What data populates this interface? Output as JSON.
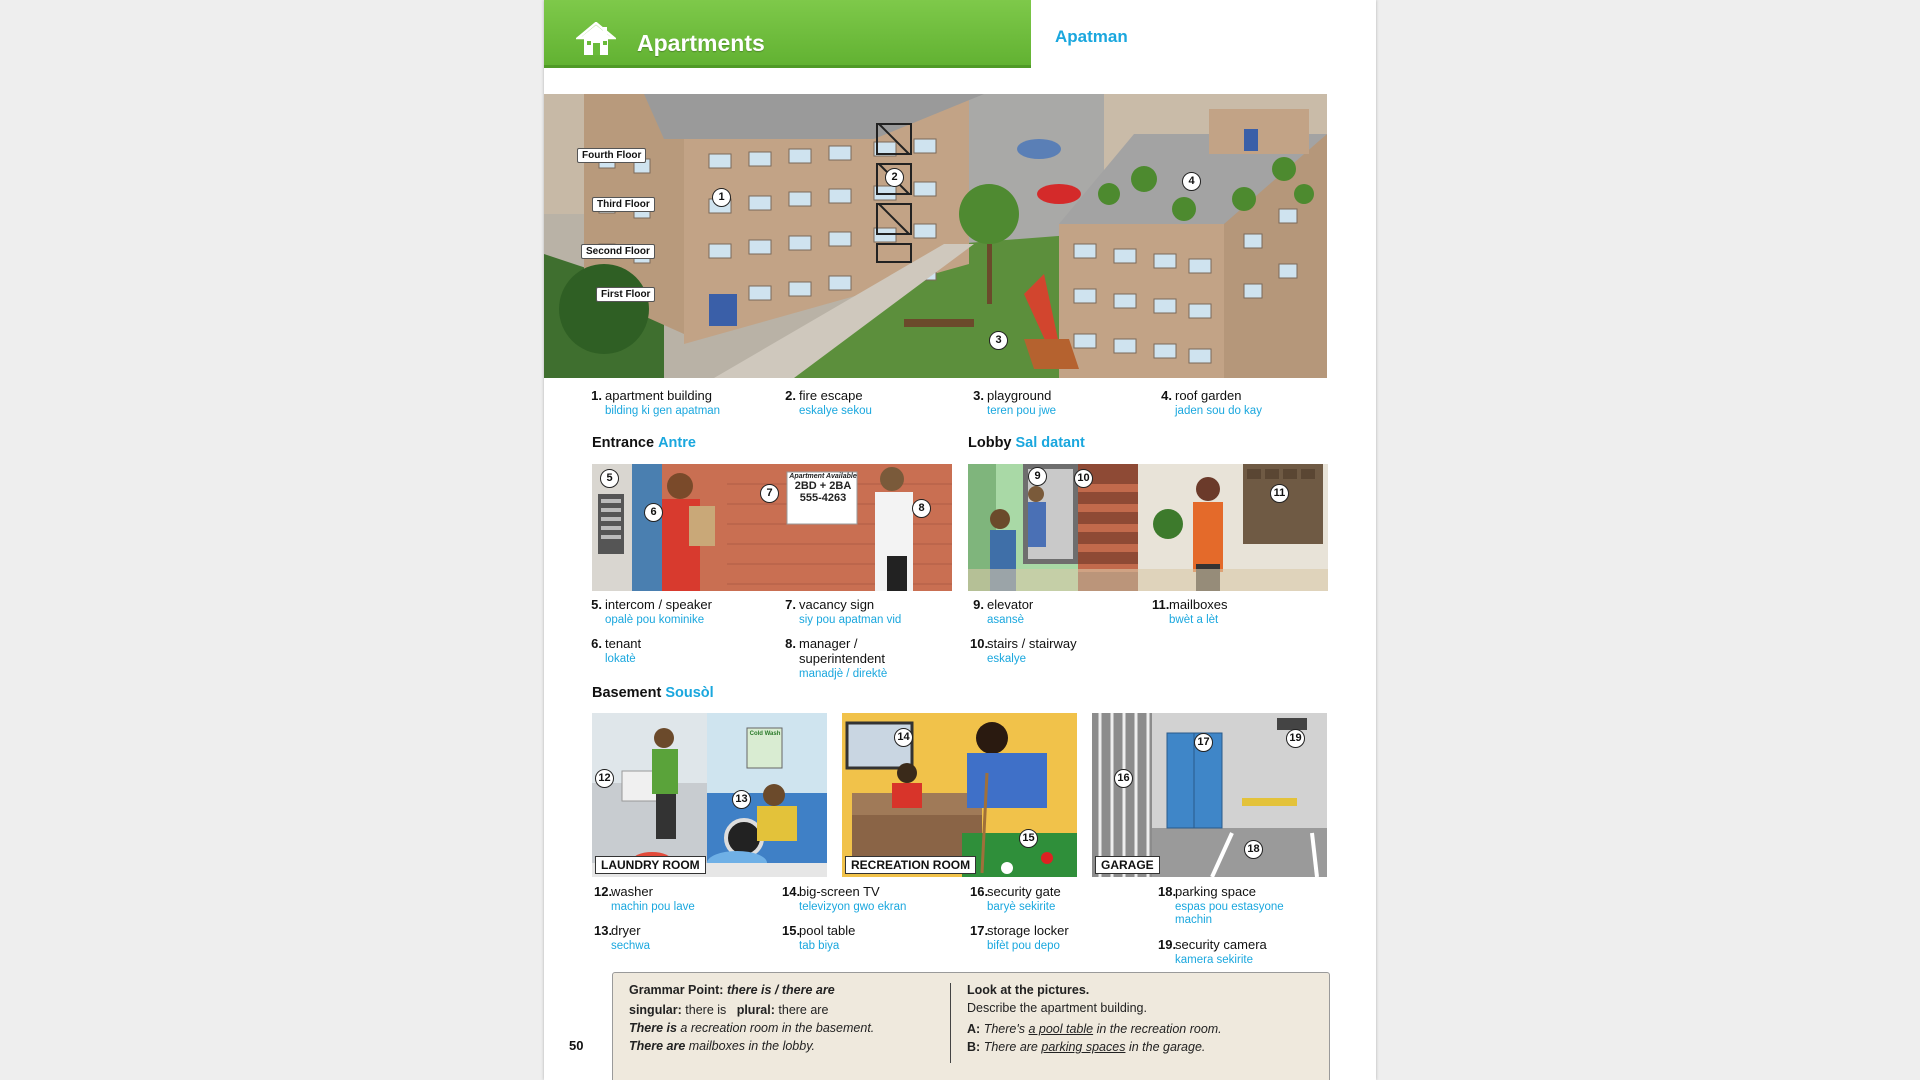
{
  "header": {
    "title": "Apartments",
    "translation": "Apatman",
    "icon": "house-icon",
    "accent": "#6abb3a",
    "translation_color": "#1aa7de"
  },
  "scene": {
    "floor_labels": [
      "Fourth Floor",
      "Third Floor",
      "Second Floor",
      "First Floor"
    ],
    "callouts": [
      "1",
      "2",
      "3",
      "4"
    ]
  },
  "vocab_top": [
    {
      "num": "1.",
      "word": "apartment building",
      "trans": "bilding ki gen apatman"
    },
    {
      "num": "2.",
      "word": "fire escape",
      "trans": "eskalye sekou"
    },
    {
      "num": "3.",
      "word": "playground",
      "trans": "teren pou jwe"
    },
    {
      "num": "4.",
      "word": "roof garden",
      "trans": "jaden sou do kay"
    }
  ],
  "entrance": {
    "title": "Entrance",
    "translation": "Antre",
    "sign_lines": [
      "Apartment Available",
      "2BD + 2BA",
      "555-4263"
    ],
    "callouts": [
      "5",
      "6",
      "7",
      "8"
    ],
    "vocab": [
      {
        "num": "5.",
        "word": "intercom / speaker",
        "trans": "opalè pou kominike"
      },
      {
        "num": "6.",
        "word": "tenant",
        "trans": "lokatè"
      },
      {
        "num": "7.",
        "word": "vacancy sign",
        "trans": "siy pou apatman vid"
      },
      {
        "num": "8.",
        "word": "manager / superintendent",
        "trans": "manadjè / direktè"
      }
    ]
  },
  "lobby": {
    "title": "Lobby",
    "translation": "Sal datant",
    "callouts": [
      "9",
      "10",
      "11"
    ],
    "vocab": [
      {
        "num": "9.",
        "word": "elevator",
        "trans": "asansè"
      },
      {
        "num": "10.",
        "word": "stairs / stairway",
        "trans": "eskalye"
      },
      {
        "num": "11.",
        "word": "mailboxes",
        "trans": "bwèt a lèt"
      }
    ]
  },
  "basement": {
    "title": "Basement",
    "translation": "Sousòl",
    "rooms": [
      "LAUNDRY ROOM",
      "RECREATION ROOM",
      "GARAGE"
    ],
    "laundry_sign": "Cold Wash",
    "callouts": [
      "12",
      "13",
      "14",
      "15",
      "16",
      "17",
      "18",
      "19"
    ],
    "vocab": [
      {
        "num": "12.",
        "word": "washer",
        "trans": "machin pou lave"
      },
      {
        "num": "13.",
        "word": "dryer",
        "trans": "sechwa"
      },
      {
        "num": "14.",
        "word": "big-screen TV",
        "trans": "televizyon gwo ekran"
      },
      {
        "num": "15.",
        "word": "pool table",
        "trans": "tab biya"
      },
      {
        "num": "16.",
        "word": "security gate",
        "trans": "baryè sekirite"
      },
      {
        "num": "17.",
        "word": "storage locker",
        "trans": "bifèt pou depo"
      },
      {
        "num": "18.",
        "word": "parking space",
        "trans": "espas pou estasyone machin"
      },
      {
        "num": "19.",
        "word": "security camera",
        "trans": "kamera sekirite"
      }
    ]
  },
  "grammar": {
    "title_label": "Grammar Point:",
    "title_rest": "there is / there are",
    "singular_label": "singular:",
    "singular_value": "there is",
    "plural_label": "plural:",
    "plural_value": "there are",
    "ex1_bold": "There is",
    "ex1_rest": "a recreation room in the basement.",
    "ex2_bold": "There are",
    "ex2_rest": "mailboxes in the lobby.",
    "look_title": "Look at the pictures.",
    "look_sub": "Describe the apartment building.",
    "a_label": "A:",
    "a_pre": "There's",
    "a_under": "a pool table",
    "a_post": "in the recreation room.",
    "b_label": "B:",
    "b_pre": "There are",
    "b_under": "parking spaces",
    "b_post": "in the garage."
  },
  "page_number": "50"
}
